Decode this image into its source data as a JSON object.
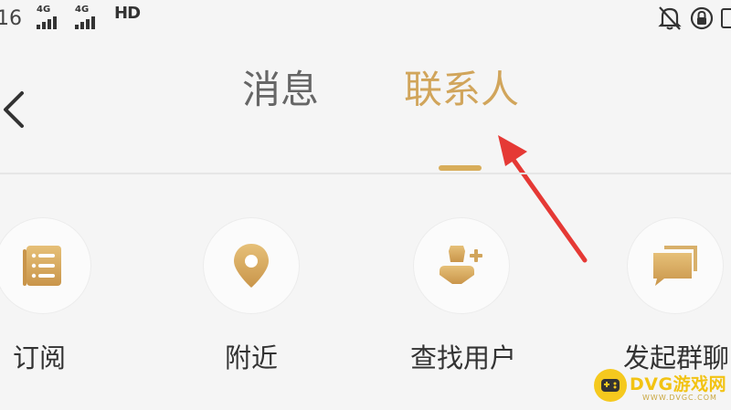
{
  "status_bar": {
    "time_fragment": "16",
    "signal_1": "4G",
    "signal_2": "4G",
    "hd_label": "HD",
    "icons": [
      "bell-off-icon",
      "lock-rotation-icon"
    ]
  },
  "header": {
    "back_icon": "chevron-left-icon",
    "tabs": [
      {
        "label": "消息",
        "active": false
      },
      {
        "label": "联系人",
        "active": true
      }
    ]
  },
  "actions": [
    {
      "label": "订阅",
      "icon": "subscription-list-icon"
    },
    {
      "label": "附近",
      "icon": "location-pin-icon"
    },
    {
      "label": "查找用户",
      "icon": "add-user-icon"
    },
    {
      "label": "发起群聊",
      "icon": "group-chat-icon"
    }
  ],
  "watermark": {
    "title": "DVG游戏网",
    "url": "WWW.DVGC.COM"
  },
  "colors": {
    "accent": "#d1a55b",
    "accent_light": "#e6c078",
    "text": "#333333",
    "muted": "#666666",
    "background": "#f5f5f5",
    "annotation_arrow": "#e53935",
    "watermark": "#f5c91e"
  }
}
